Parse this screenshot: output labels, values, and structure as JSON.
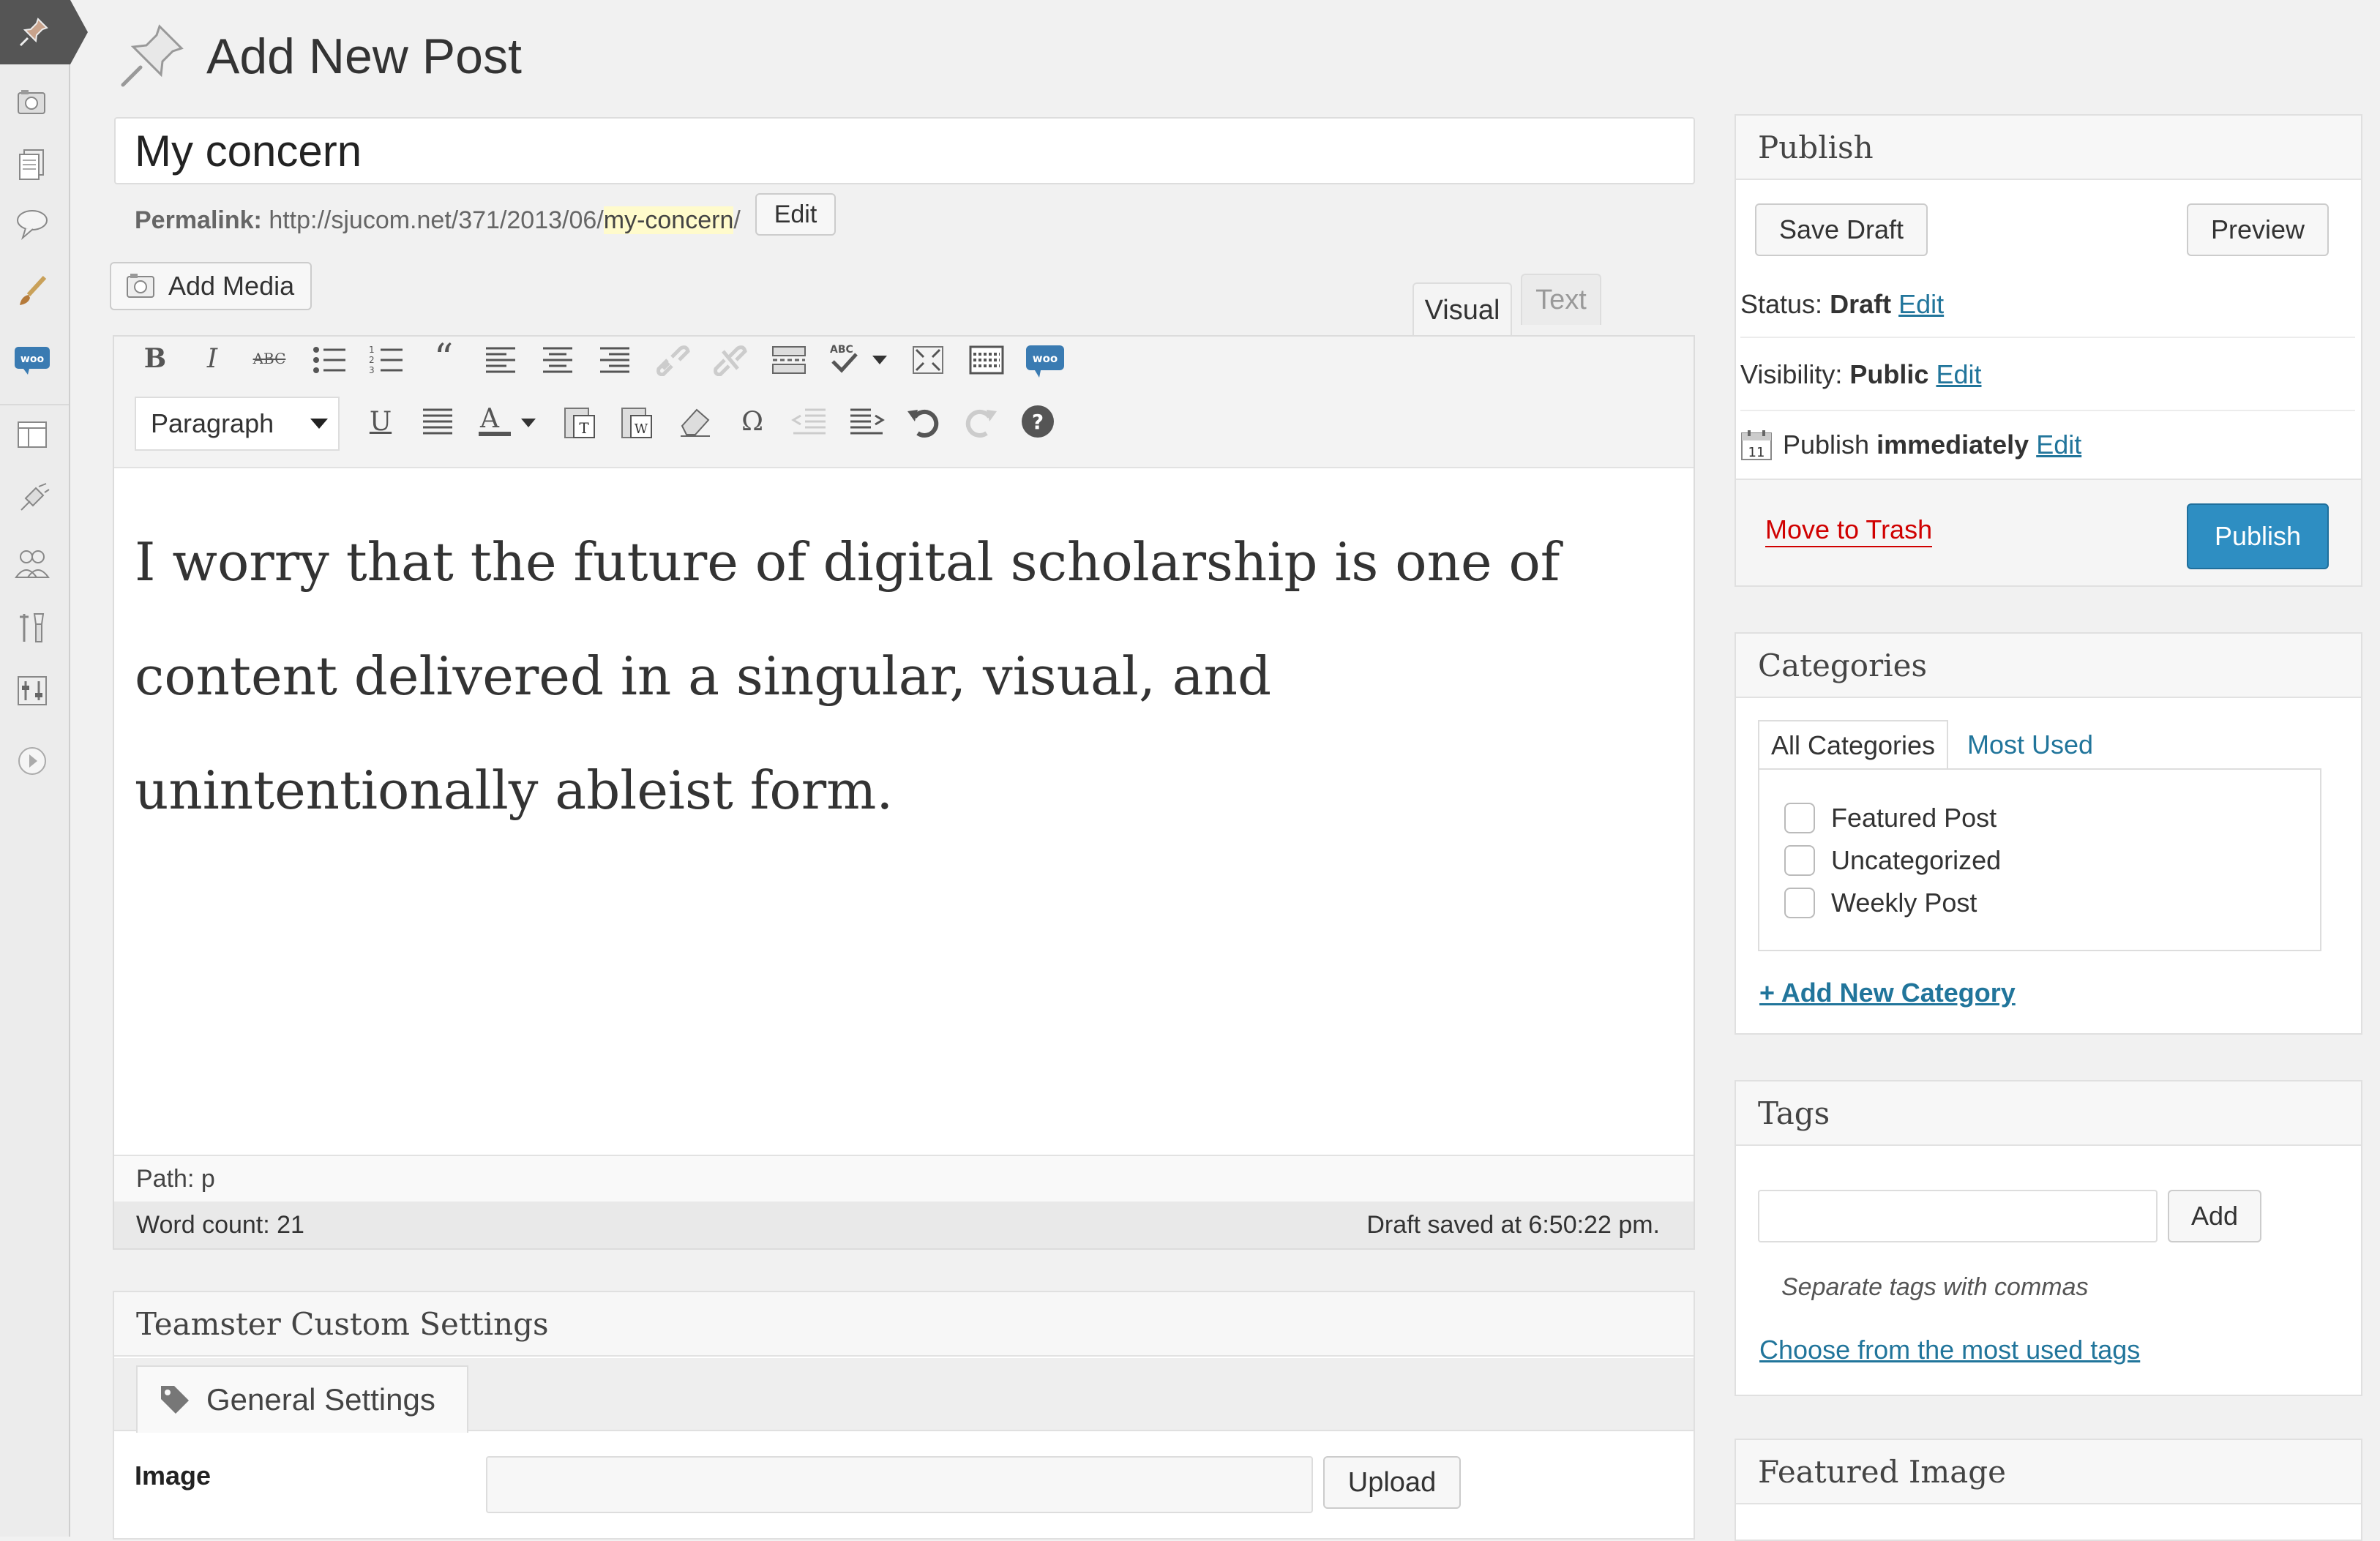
{
  "page": {
    "title": "Add New Post"
  },
  "post": {
    "title": "My concern",
    "permalink_label": "Permalink:",
    "permalink_base": "http://sjucom.net/371/2013/06/",
    "permalink_slug": "my-concern",
    "permalink_tail": "/",
    "permalink_edit": "Edit",
    "content": "I worry that the future of digital scholarship is one of content delivered in a singular, visual, and unintentionally ableist form."
  },
  "editor": {
    "add_media": "Add Media",
    "tabs": [
      "Visual",
      "Text"
    ],
    "format_select": "Paragraph",
    "path": "Path: p",
    "word_count": "Word count: 21",
    "draft_saved": "Draft saved at 6:50:22 pm."
  },
  "teamster": {
    "title": "Teamster Custom Settings",
    "tab": "General Settings",
    "image_label": "Image",
    "upload": "Upload"
  },
  "publish": {
    "title": "Publish",
    "save_draft": "Save Draft",
    "preview": "Preview",
    "status_label": "Status:",
    "status_value": "Draft",
    "visibility_label": "Visibility:",
    "visibility_value": "Public",
    "schedule_label": "Publish",
    "schedule_value": "immediately",
    "edit": "Edit",
    "trash": "Move to Trash",
    "publish_btn": "Publish",
    "calendar_day": "11"
  },
  "categories": {
    "title": "Categories",
    "tab_all": "All Categories",
    "tab_used": "Most Used",
    "items": [
      "Featured Post",
      "Uncategorized",
      "Weekly Post"
    ],
    "add_new": "+ Add New Category"
  },
  "tags": {
    "title": "Tags",
    "add": "Add",
    "hint": "Separate tags with commas",
    "choose": "Choose from the most used tags"
  },
  "featured_image": {
    "title": "Featured Image"
  },
  "colors": {
    "accent": "#21759b",
    "publish_button": "#2e8ec2",
    "trash": "#d00000"
  }
}
